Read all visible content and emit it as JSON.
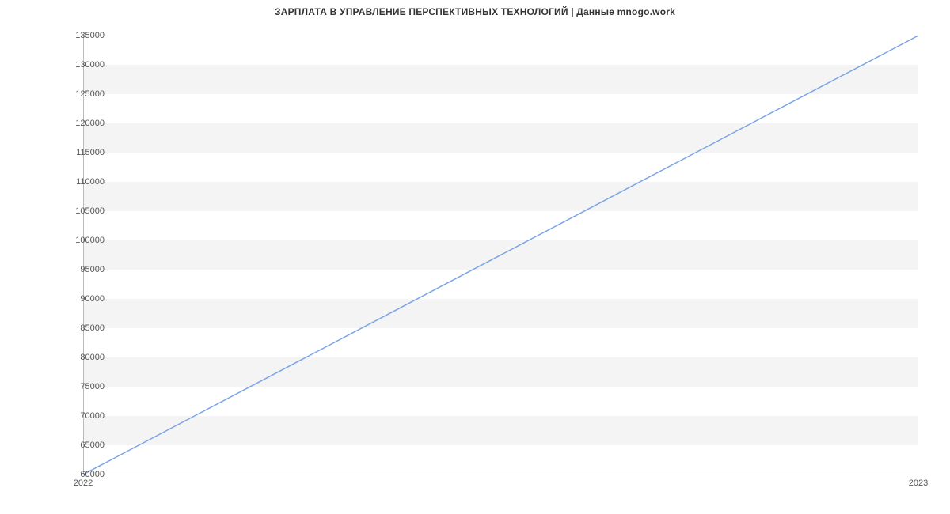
{
  "chart_data": {
    "type": "line",
    "title": "ЗАРПЛАТА В  УПРАВЛЕНИЕ ПЕРСПЕКТИВНЫХ ТЕХНОЛОГИЙ | Данные mnogo.work",
    "xlabel": "",
    "ylabel": "",
    "x": [
      2022,
      2023
    ],
    "values": [
      60000,
      135000
    ],
    "x_ticks": [
      2022,
      2023
    ],
    "y_ticks": [
      60000,
      65000,
      70000,
      75000,
      80000,
      85000,
      90000,
      95000,
      100000,
      105000,
      110000,
      115000,
      120000,
      125000,
      130000,
      135000
    ],
    "xlim": [
      2022,
      2023
    ],
    "ylim": [
      60000,
      135000
    ],
    "line_color": "#7ba4e8",
    "grid_band_color": "#f4f4f4"
  }
}
